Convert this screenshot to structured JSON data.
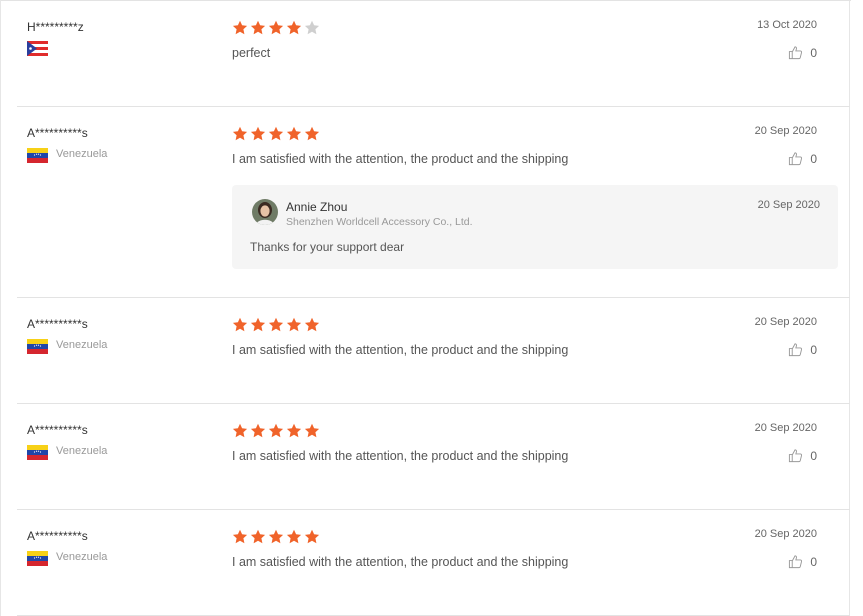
{
  "colors": {
    "star_filled": "#f0632a",
    "star_empty": "#cfcfcf"
  },
  "reviews": [
    {
      "user": "H*********z",
      "flag": "puerto-rico-flag",
      "country": "",
      "rating": 4,
      "text": "perfect",
      "date": "13 Oct 2020",
      "likes": "0"
    },
    {
      "user": "A**********s",
      "flag": "venezuela-flag",
      "country": "Venezuela",
      "rating": 5,
      "text": "I am satisfied with the attention, the product and the shipping",
      "date": "20 Sep 2020",
      "likes": "0",
      "reply": {
        "name": "Annie Zhou",
        "company": "Shenzhen Worldcell Accessory Co., Ltd.",
        "date": "20 Sep 2020",
        "text": "Thanks for your support dear"
      }
    },
    {
      "user": "A**********s",
      "flag": "venezuela-flag",
      "country": "Venezuela",
      "rating": 5,
      "text": "I am satisfied with the attention, the product and the shipping",
      "date": "20 Sep 2020",
      "likes": "0"
    },
    {
      "user": "A**********s",
      "flag": "venezuela-flag",
      "country": "Venezuela",
      "rating": 5,
      "text": "I am satisfied with the attention, the product and the shipping",
      "date": "20 Sep 2020",
      "likes": "0"
    },
    {
      "user": "A**********s",
      "flag": "venezuela-flag",
      "country": "Venezuela",
      "rating": 5,
      "text": "I am satisfied with the attention, the product and the shipping",
      "date": "20 Sep 2020",
      "likes": "0"
    }
  ]
}
